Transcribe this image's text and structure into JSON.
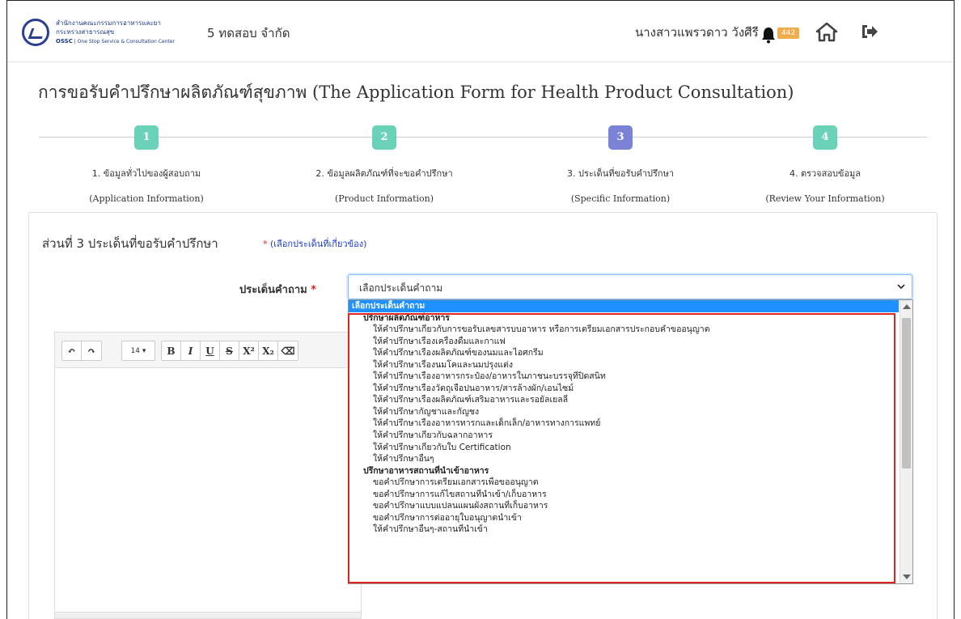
{
  "header": {
    "logo_line1": "สำนักงานคณะกรรมการอาหารและยา",
    "logo_line2": "กระทรวงสาธารณสุข",
    "logo_line3_bold": "OSSC",
    "logo_line3": "| One Stop Service & Consultation Center",
    "company": "5 ทดสอบ จำกัด",
    "username": "นางสาวแพรวดาว วังศีรี",
    "notification_count": "442"
  },
  "page_title": "การขอรับคำปรึกษาผลิตภัณฑ์สุขภาพ (The Application Form for Health Product Consultation)",
  "steps": [
    {
      "num": "1",
      "label": "1. ข้อมูลทั่วไปของผู้สอบถาม",
      "sub": "(Application Information)",
      "active": false
    },
    {
      "num": "2",
      "label": "2. ข้อมูลผลิตภัณฑ์ที่จะขอคำปรึกษา",
      "sub": "(Product Information)",
      "active": false
    },
    {
      "num": "3",
      "label": "3. ประเด็นที่ขอรับคำปรึกษา",
      "sub": "(Specific Information)",
      "active": true
    },
    {
      "num": "4",
      "label": "4. ตรวจสอบข้อมูล",
      "sub": "(Review Your Information)",
      "active": false
    }
  ],
  "section": {
    "title": "ส่วนที่ 3 ประเด็นที่ขอรับคำปรึกษา",
    "note_star": "*",
    "note": "(เลือกประเด็นที่เกี่ยวข้อง)"
  },
  "question": {
    "label": "ประเด็นคำถาม",
    "star": "*",
    "selected_value": "เลือกประเด็นคำถาม"
  },
  "editor": {
    "font_size": "14",
    "buttons": [
      "↶",
      "↷",
      "B",
      "I",
      "U",
      "S",
      "X²",
      "X₂",
      "⌫"
    ]
  },
  "dropdown": {
    "items": [
      {
        "type": "selected",
        "text": "เลือกประเด็นคำถาม"
      },
      {
        "type": "group",
        "text": "ปรึกษาผลิตภัณฑ์อาหาร"
      },
      {
        "type": "opt",
        "text": "ให้คำปรึกษาเกี่ยวกับการขอรับเลขสารบบอาหาร หรือการเตรียมเอกสารประกอบคำขออนุญาต"
      },
      {
        "type": "opt",
        "text": "ให้คำปรึกษาเรื่องเครื่องดื่มและกาแฟ"
      },
      {
        "type": "opt",
        "text": "ให้คำปรึกษาเรื่องผลิตภัณฑ์ของนมและไอศกรีม"
      },
      {
        "type": "opt",
        "text": "ให้คำปรึกษาเรื่องนมโคและนมปรุงแต่ง"
      },
      {
        "type": "opt",
        "text": "ให้คำปรึกษาเรื่องอาหารกระป๋อง/อาหารในภาชนะบรรจุที่ปิดสนิท"
      },
      {
        "type": "opt",
        "text": "ให้คำปรึกษาเรื่องวัตถุเจือปนอาหาร/สารล้างผัก/เอนไซม์"
      },
      {
        "type": "opt",
        "text": "ให้คำปรึกษาเรื่องผลิตภัณฑ์เสริมอาหารและรอยัลเยลลี่"
      },
      {
        "type": "opt",
        "text": "ให้คำปรึกษากัญชาและกัญชง"
      },
      {
        "type": "opt",
        "text": "ให้คำปรึกษาเรื่องอาหารทารกและเด็กเล็ก/อาหารทางการแพทย์"
      },
      {
        "type": "opt",
        "text": "ให้คำปรึกษาเกี่ยวกับฉลากอาหาร"
      },
      {
        "type": "opt",
        "text": "ให้คำปรึกษาเกี่ยวกับใบ Certification"
      },
      {
        "type": "opt",
        "text": "ให้คำปรึกษาอื่นๆ"
      },
      {
        "type": "group",
        "text": "ปรึกษาอาหารสถานที่นำเข้าอาหาร"
      },
      {
        "type": "opt",
        "text": "ขอคำปรึกษาการเตรียมเอกสารเพื่อขออนุญาต"
      },
      {
        "type": "opt",
        "text": "ขอคำปรึกษาการแก้ไขสถานที่นำเข้า/เก็บอาหาร"
      },
      {
        "type": "opt",
        "text": "ขอคำปรึกษาแบบแปลนแผนผังสถานที่เก็บอาหาร"
      },
      {
        "type": "opt",
        "text": "ขอคำปรึกษาการต่ออายุใบอนุญาตนำเข้า"
      },
      {
        "type": "opt",
        "text": "ให้คำปรึกษาอื่นๆ-สถานที่นำเข้า"
      }
    ]
  },
  "colors": {
    "step_done": "#69d2b9",
    "step_active": "#7b83d6",
    "highlight": "#e02424",
    "selected_bg": "#1e90ff",
    "badge": "#f0ad4e"
  }
}
